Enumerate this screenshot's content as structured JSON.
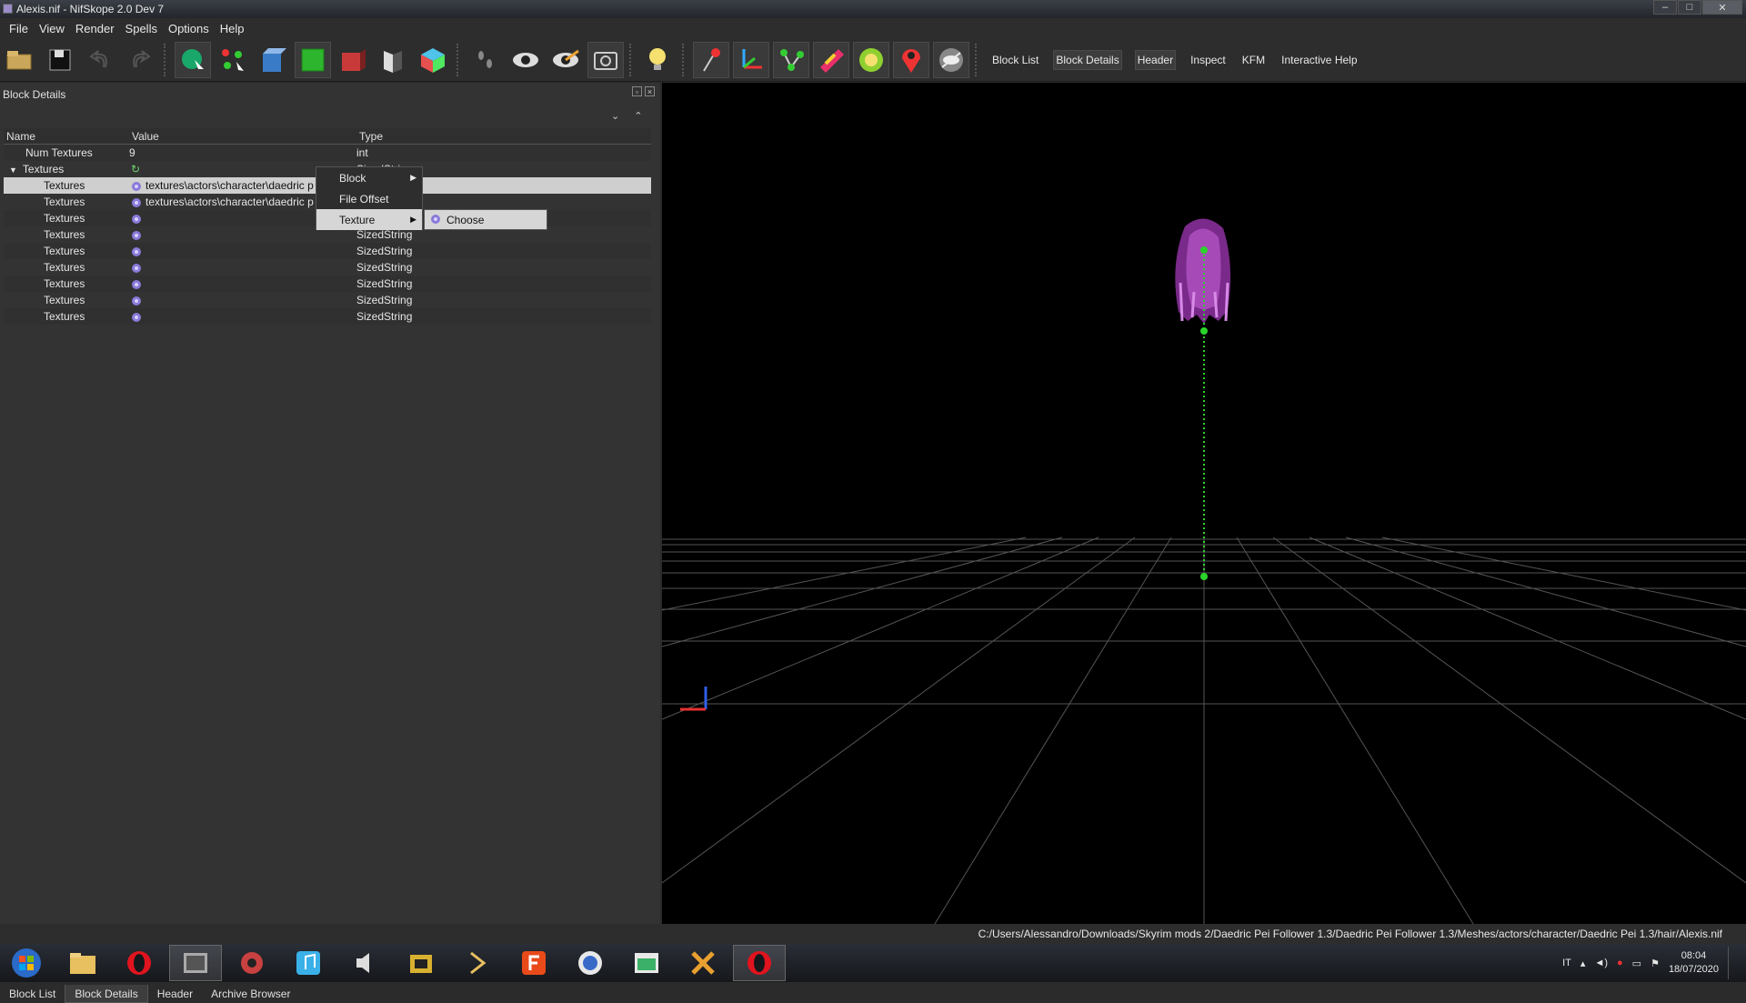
{
  "window": {
    "title": "Alexis.nif - NifSkope 2.0 Dev 7",
    "controls": [
      "–",
      "□",
      "✕"
    ]
  },
  "menu": [
    "File",
    "View",
    "Render",
    "Spells",
    "Options",
    "Help"
  ],
  "toolbar": {
    "links": [
      "Block List",
      "Block Details",
      "Header",
      "Inspect",
      "KFM",
      "Interactive Help"
    ],
    "active_link": "Block Details"
  },
  "panel": {
    "title": "Block Details",
    "columns": [
      "Name",
      "Value",
      "Type"
    ],
    "rows": [
      {
        "name": "Num Textures",
        "value": "9",
        "type": "int"
      },
      {
        "name": "Textures",
        "value": "",
        "type": "SizedString"
      },
      {
        "name": "Textures",
        "value": "textures\\actors\\character\\daedric p",
        "type": ""
      },
      {
        "name": "Textures",
        "value": "textures\\actors\\character\\daedric p",
        "type": ""
      },
      {
        "name": "Textures",
        "value": "",
        "type": ""
      },
      {
        "name": "Textures",
        "value": "",
        "type": "SizedString"
      },
      {
        "name": "Textures",
        "value": "",
        "type": "SizedString"
      },
      {
        "name": "Textures",
        "value": "",
        "type": "SizedString"
      },
      {
        "name": "Textures",
        "value": "",
        "type": "SizedString"
      },
      {
        "name": "Textures",
        "value": "",
        "type": "SizedString"
      },
      {
        "name": "Textures",
        "value": "",
        "type": "SizedString"
      }
    ]
  },
  "context_menu": {
    "items": [
      "Block",
      "File Offset",
      "Texture"
    ],
    "submenu": [
      "Choose"
    ]
  },
  "bottom_tabs": [
    "Block List",
    "Block Details",
    "Header",
    "Archive Browser"
  ],
  "status": {
    "path": "C:/Users/Alessandro/Downloads/Skyrim mods 2/Daedric Pei Follower 1.3/Daedric Pei Follower 1.3/Meshes/actors/character/Daedric Pei 1.3/hair/Alexis.nif"
  },
  "taskbar": {
    "lang": "IT",
    "time": "08:04",
    "date": "18/07/2020"
  }
}
